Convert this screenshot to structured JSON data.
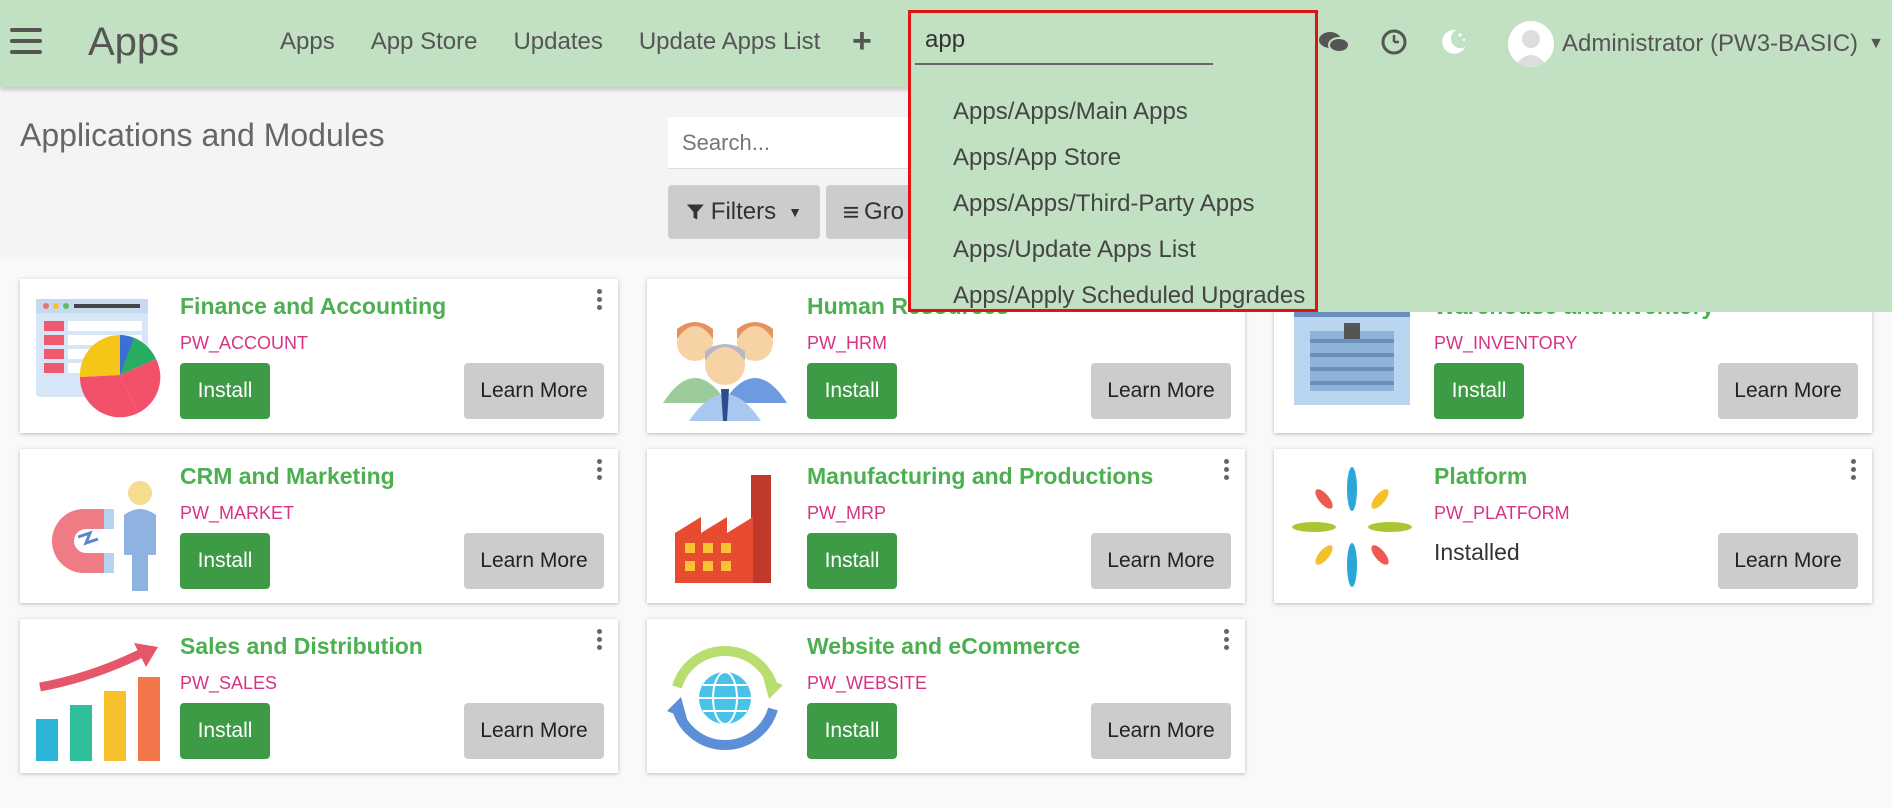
{
  "navbar": {
    "title": "Apps",
    "links": [
      "Apps",
      "App Store",
      "Updates",
      "Update Apps List"
    ],
    "plus": "+",
    "user": "Administrator (PW3-BASIC)"
  },
  "palette": {
    "query": "app",
    "items": [
      "Apps/Apps/Main Apps",
      "Apps/App Store",
      "Apps/Apps/Third-Party Apps",
      "Apps/Update Apps List",
      "Apps/Apply Scheduled Upgrades"
    ]
  },
  "control": {
    "title": "Applications and Modules",
    "search_placeholder": "Search...",
    "filters_label": "Filters",
    "group_label": "Gro"
  },
  "cards": [
    {
      "name": "Finance and Accounting",
      "code": "PW_ACCOUNT",
      "install": "Install",
      "learn": "Learn More",
      "icon": "finance-chart-icon"
    },
    {
      "name": "Human Resources",
      "code": "PW_HRM",
      "install": "Install",
      "learn": "Learn More",
      "icon": "people-group-icon"
    },
    {
      "name": "Warehouse and Inventory",
      "code": "PW_INVENTORY",
      "install": "Install",
      "learn": "Learn More",
      "icon": "warehouse-icon"
    },
    {
      "name": "CRM and Marketing",
      "code": "PW_MARKET",
      "install": "Install",
      "learn": "Learn More",
      "icon": "magnet-person-icon"
    },
    {
      "name": "Manufacturing and Productions",
      "code": "PW_MRP",
      "install": "Install",
      "learn": "Learn More",
      "icon": "factory-icon"
    },
    {
      "name": "Platform",
      "code": "PW_PLATFORM",
      "status": "Installed",
      "learn": "Learn More",
      "icon": "platform-burst-icon"
    },
    {
      "name": "Sales and Distribution",
      "code": "PW_SALES",
      "install": "Install",
      "learn": "Learn More",
      "icon": "sales-growth-icon"
    },
    {
      "name": "Website and eCommerce",
      "code": "PW_WEBSITE",
      "install": "Install",
      "learn": "Learn More",
      "icon": "globe-cycle-icon"
    }
  ],
  "colors": {
    "navbar_bg": "#c2e0c2",
    "accent_green": "#4caf50",
    "install_green": "#3d9b45",
    "code_pink": "#d63384",
    "highlight_red": "#e01414"
  }
}
